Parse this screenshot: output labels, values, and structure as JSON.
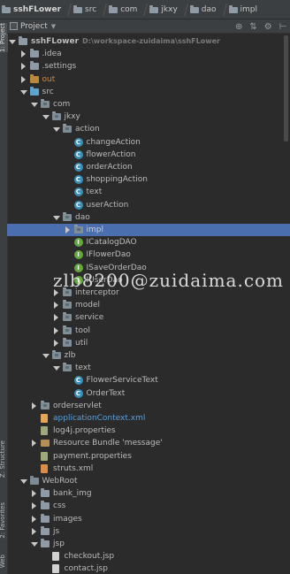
{
  "breadcrumb": [
    "sshFLower",
    "src",
    "com",
    "jkxy",
    "dao",
    "impl"
  ],
  "left_strip": {
    "project_tab": "1: Project",
    "structure_tab": "Z: Structure",
    "favorites_tab": "2: Favorites",
    "web_tab": "Web"
  },
  "project_view": {
    "title": "Project",
    "icons": [
      "target-icon",
      "settings-icon",
      "gear-icon",
      "hide-icon"
    ]
  },
  "tree": [
    {
      "label": "sshFLower",
      "suffix": "D:\\workspace-zuidaima\\sshFLower",
      "depth": 0,
      "expanded": true,
      "icon": "module-folder",
      "bold": true
    },
    {
      "label": ".idea",
      "depth": 1,
      "expanded": false,
      "icon": "folder"
    },
    {
      "label": ".settings",
      "depth": 1,
      "expanded": false,
      "icon": "folder"
    },
    {
      "label": "out",
      "depth": 1,
      "expanded": false,
      "icon": "folder-orange",
      "color": "orange"
    },
    {
      "label": "src",
      "depth": 1,
      "expanded": true,
      "icon": "folder-blue"
    },
    {
      "label": "com",
      "depth": 2,
      "expanded": true,
      "icon": "package"
    },
    {
      "label": "jkxy",
      "depth": 3,
      "expanded": true,
      "icon": "package"
    },
    {
      "label": "action",
      "depth": 4,
      "expanded": true,
      "icon": "package"
    },
    {
      "label": "changeAction",
      "depth": 5,
      "icon": "class"
    },
    {
      "label": "flowerAction",
      "depth": 5,
      "icon": "class"
    },
    {
      "label": "orderAction",
      "depth": 5,
      "icon": "class"
    },
    {
      "label": "shoppingAction",
      "depth": 5,
      "icon": "class"
    },
    {
      "label": "text",
      "depth": 5,
      "icon": "class"
    },
    {
      "label": "userAction",
      "depth": 5,
      "icon": "class"
    },
    {
      "label": "dao",
      "depth": 4,
      "expanded": true,
      "icon": "package"
    },
    {
      "label": "impl",
      "depth": 5,
      "expanded": false,
      "icon": "package",
      "selected": true
    },
    {
      "label": "ICatalogDAO",
      "depth": 5,
      "icon": "interface"
    },
    {
      "label": "IFlowerDao",
      "depth": 5,
      "icon": "interface"
    },
    {
      "label": "ISaveOrderDao",
      "depth": 5,
      "icon": "interface"
    },
    {
      "label": "IUserDao",
      "depth": 5,
      "icon": "interface"
    },
    {
      "label": "interceptor",
      "depth": 4,
      "expanded": false,
      "icon": "package"
    },
    {
      "label": "model",
      "depth": 4,
      "expanded": false,
      "icon": "package"
    },
    {
      "label": "service",
      "depth": 4,
      "expanded": false,
      "icon": "package"
    },
    {
      "label": "tool",
      "depth": 4,
      "expanded": false,
      "icon": "package"
    },
    {
      "label": "util",
      "depth": 4,
      "expanded": false,
      "icon": "package"
    },
    {
      "label": "zlb",
      "depth": 3,
      "expanded": true,
      "icon": "package"
    },
    {
      "label": "text",
      "depth": 4,
      "expanded": true,
      "icon": "package"
    },
    {
      "label": "FlowerServiceText",
      "depth": 5,
      "icon": "class"
    },
    {
      "label": "OrderText",
      "depth": 5,
      "icon": "class"
    },
    {
      "label": "orderservlet",
      "depth": 2,
      "expanded": false,
      "icon": "package"
    },
    {
      "label": "applicationContext.xml",
      "depth": 2,
      "icon": "xml-file",
      "color": "blue"
    },
    {
      "label": "log4j.properties",
      "depth": 2,
      "icon": "properties-file"
    },
    {
      "label": "Resource Bundle 'message'",
      "depth": 2,
      "expanded": false,
      "icon": "bundle"
    },
    {
      "label": "payment.properties",
      "depth": 2,
      "icon": "properties-file"
    },
    {
      "label": "struts.xml",
      "depth": 2,
      "icon": "struts-file"
    },
    {
      "label": "WebRoot",
      "depth": 1,
      "expanded": true,
      "icon": "folder-plain"
    },
    {
      "label": "bank_img",
      "depth": 2,
      "expanded": false,
      "icon": "folder"
    },
    {
      "label": "css",
      "depth": 2,
      "expanded": false,
      "icon": "folder"
    },
    {
      "label": "images",
      "depth": 2,
      "expanded": false,
      "icon": "folder"
    },
    {
      "label": "js",
      "depth": 2,
      "expanded": false,
      "icon": "folder"
    },
    {
      "label": "jsp",
      "depth": 2,
      "expanded": true,
      "icon": "folder"
    },
    {
      "label": "checkout.jsp",
      "depth": 3,
      "icon": "jsp-file"
    },
    {
      "label": "contact.jsp",
      "depth": 3,
      "icon": "jsp-file"
    }
  ],
  "watermark": "zlb8200@zuidaima.com",
  "colors": {
    "background": "#2b2b2b",
    "panel": "#3c3f41",
    "selection": "#4b6eaf",
    "class_icon": "#3a8fb7",
    "interface_icon": "#62a83c"
  }
}
